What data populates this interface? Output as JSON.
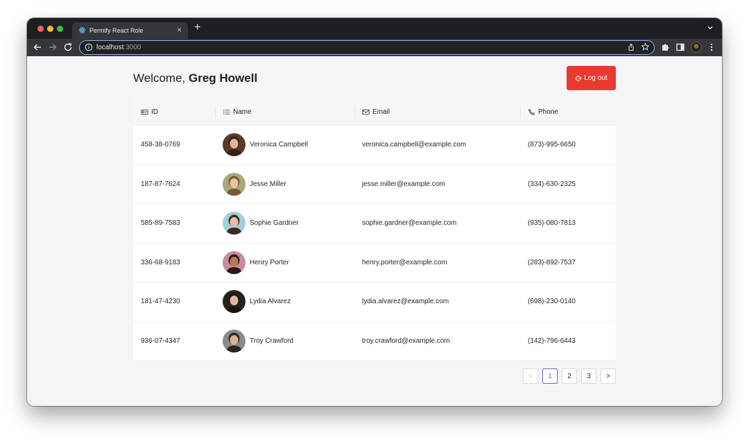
{
  "browser": {
    "tab_title": "Permify React Role",
    "tab_close": "×",
    "new_tab": "+",
    "url_host": "localhost",
    "url_port": ":3000"
  },
  "header": {
    "welcome_prefix": "Welcome, ",
    "user_name": "Greg Howell",
    "logout_label": "Log out"
  },
  "table": {
    "columns": [
      {
        "label": "ID",
        "icon": "id-card-icon"
      },
      {
        "label": "Name",
        "icon": "list-icon"
      },
      {
        "label": "Email",
        "icon": "mail-icon"
      },
      {
        "label": "Phone",
        "icon": "phone-icon"
      }
    ],
    "rows": [
      {
        "id": "458-38-0769",
        "name": "Veronica Campbell",
        "email": "veronica.campbell@example.com",
        "phone": "(873)-995-6650",
        "avatar_bg": "#5a3a2a",
        "avatar_skin": "#e0b495",
        "avatar_hair": "#3a2116"
      },
      {
        "id": "187-87-7624",
        "name": "Jesse Miller",
        "email": "jesse.miller@example.com",
        "phone": "(334)-630-2325",
        "avatar_bg": "#a8a878",
        "avatar_skin": "#e8c3a0",
        "avatar_hair": "#7a5a34"
      },
      {
        "id": "585-89-7583",
        "name": "Sophie Gardner",
        "email": "sophie.gardner@example.com",
        "phone": "(935)-080-7813",
        "avatar_bg": "#9fd0dc",
        "avatar_skin": "#e6c0a6",
        "avatar_hair": "#3b2b22"
      },
      {
        "id": "336-68-9183",
        "name": "Henry Porter",
        "email": "henry.porter@example.com",
        "phone": "(283)-892-7537",
        "avatar_bg": "#c98aa0",
        "avatar_skin": "#b87a58",
        "avatar_hair": "#2b1a12"
      },
      {
        "id": "181-47-4230",
        "name": "Lydia Alvarez",
        "email": "lydia.alvarez@example.com",
        "phone": "(698)-230-0140",
        "avatar_bg": "#2a211c",
        "avatar_skin": "#e2b79c",
        "avatar_hair": "#1c130f"
      },
      {
        "id": "936-07-4347",
        "name": "Troy Crawford",
        "email": "troy.crawford@example.com",
        "phone": "(142)-796-6443",
        "avatar_bg": "#8a8a88",
        "avatar_skin": "#dcb292",
        "avatar_hair": "#2d2520"
      }
    ]
  },
  "pagination": {
    "prev": "<",
    "next": ">",
    "pages": [
      "1",
      "2",
      "3"
    ],
    "current_page": 1
  },
  "colors": {
    "accent_logout": "#e83a30",
    "pagination_active": "#7b61b8",
    "omnibox_focus": "#8ab4f8"
  }
}
